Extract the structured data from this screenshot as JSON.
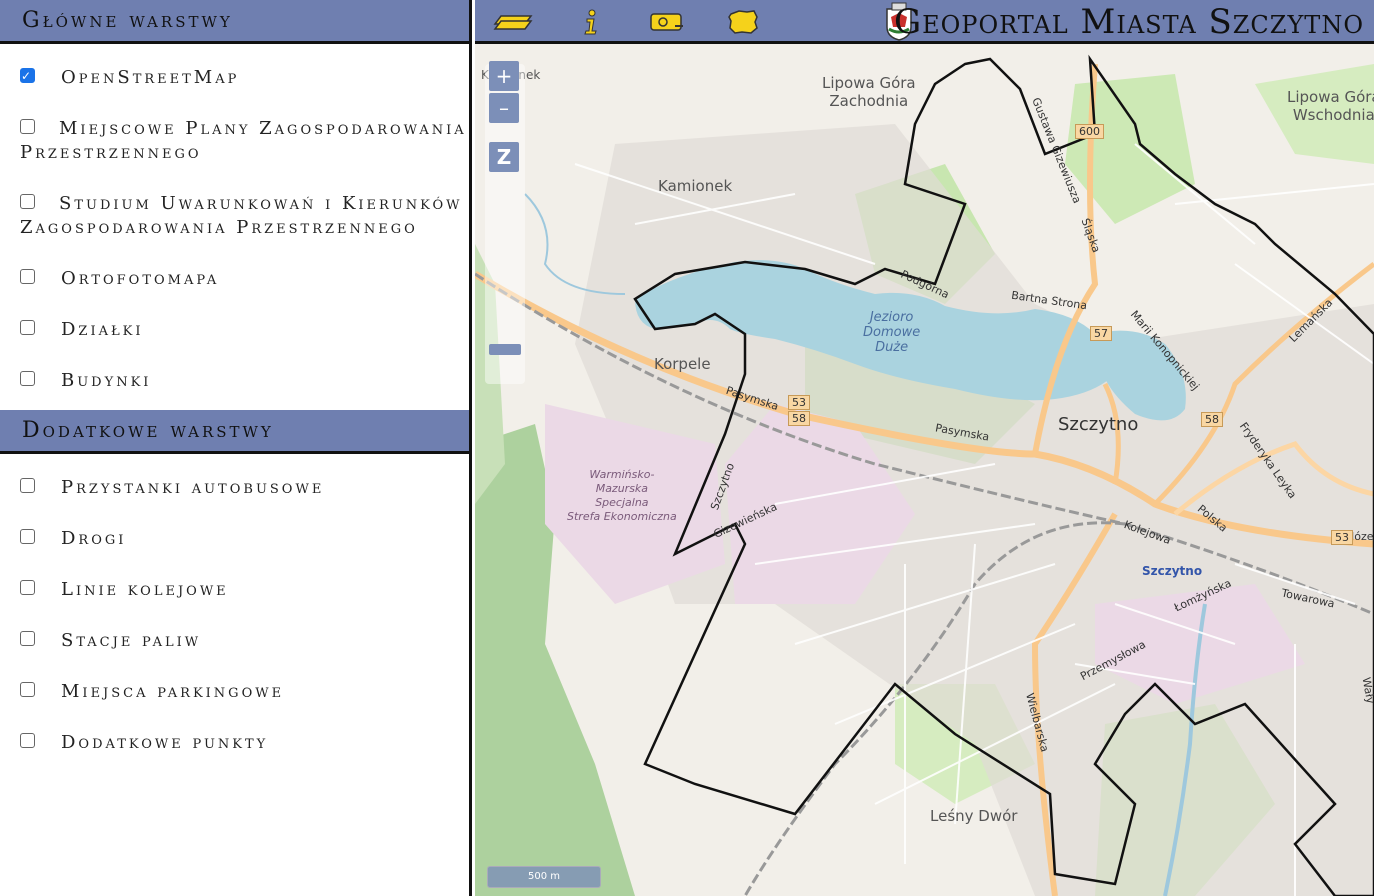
{
  "sidebar": {
    "main_header": "Główne warstwy",
    "main_layers": [
      {
        "label": "OpenStreetMap",
        "checked": true
      },
      {
        "label": "Miejscowe Plany Zagospodarowania Przestrzennego",
        "checked": false
      },
      {
        "label": "Studium Uwarunkowań i Kierunków Zagospodarowania Przestrzennego",
        "checked": false
      },
      {
        "label": "Ortofotomapa",
        "checked": false
      },
      {
        "label": "Działki",
        "checked": false
      },
      {
        "label": "Budynki",
        "checked": false
      }
    ],
    "extra_header": "Dodatkowe warstwy",
    "extra_layers": [
      {
        "label": "Przystanki autobusowe",
        "checked": false
      },
      {
        "label": "Drogi",
        "checked": false
      },
      {
        "label": "Linie kolejowe",
        "checked": false
      },
      {
        "label": "Stacje paliw",
        "checked": false
      },
      {
        "label": "Miejsca parkingowe",
        "checked": false
      },
      {
        "label": "Dodatkowe punkty",
        "checked": false
      }
    ]
  },
  "topbar": {
    "title": "Geoportal Miasta Szczytno",
    "tools": [
      "layers-icon",
      "info-icon",
      "measure-icon",
      "poland-map-icon"
    ]
  },
  "map": {
    "zoom_in": "+",
    "zoom_out": "–",
    "zoom_extent": "Z",
    "scale_label": "500 m",
    "places": {
      "kamionek": "Kamionek",
      "kamionek_top": "Kamionek",
      "lipowa_zach_1": "Lipowa Góra",
      "lipowa_zach_2": "Zachodnia",
      "lipowa_wsch_1": "Lipowa Góra",
      "lipowa_wsch_2": "Wschodnia",
      "korpele": "Korpele",
      "szczytno": "Szczytno",
      "lesny_dwor": "Leśny Dwór",
      "lake_1": "Jezioro",
      "lake_2": "Domowe",
      "lake_3": "Duże",
      "zone_1": "Warmińsko-",
      "zone_2": "Mazurska",
      "zone_3": "Specjalna",
      "zone_4": "Strefa Ekonomiczna",
      "station": "Szczytno"
    },
    "roads": {
      "pasymska_1": "Pasymska",
      "pasymska_2": "Pasymska",
      "bartna": "Bartna Strona",
      "podgorna": "Podgórna",
      "slaska": "Śląska",
      "gizewiusza": "Gustawa Gizewiusza",
      "konopnickiej": "Marii Konopnickiej",
      "lemanska": "Lemańska",
      "fryderyka": "Fryderyka Leyka",
      "polska": "Polska",
      "kolejowa": "Kolejowa",
      "lomzynska": "Łomżyńska",
      "towarowa": "Towarowa",
      "przemyslowa": "Przemysłowa",
      "wielbarska": "Wielbarska",
      "szczytno_st": "Szczytno",
      "gizewienska": "Gizewieńska",
      "wawy": "Wały",
      "jozefa": "Józe"
    },
    "shields": {
      "s600": "600",
      "s57": "57",
      "s53a": "53",
      "s58a": "58",
      "s58b": "58",
      "s53b": "53"
    }
  }
}
